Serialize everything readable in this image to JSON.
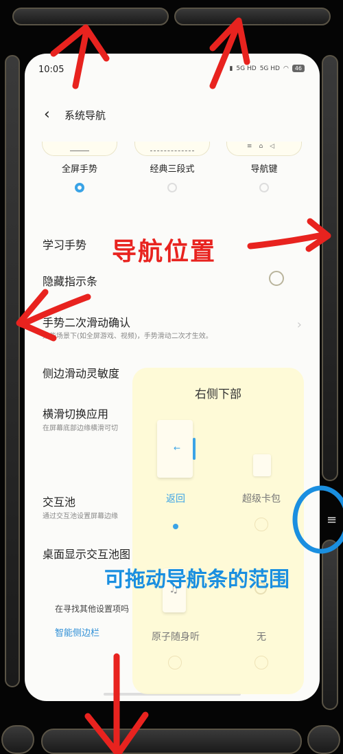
{
  "status_bar": {
    "time": "10:05",
    "signal1": "5G HD",
    "signal2": "5G HD",
    "battery": "46"
  },
  "header": {
    "title": "系统导航"
  },
  "nav_modes": {
    "options": [
      {
        "label": "全屏手势",
        "selected": true
      },
      {
        "label": "经典三段式",
        "selected": false
      },
      {
        "label": "导航键",
        "selected": false
      }
    ]
  },
  "settings": {
    "learn_gesture": "学习手势",
    "hide_indicator": "隐藏指示条",
    "gesture_confirm": "手势二次滑动确认",
    "gesture_confirm_desc": "某些场景下(如全屏游戏、视频)，手势滑动二次才生效。",
    "side_sensitivity": "侧边滑动灵敏度",
    "swipe_switch": "横滑切换应用",
    "swipe_switch_desc": "在屏幕底部边缘横滑可切",
    "interaction_pool": "交互池",
    "interaction_pool_desc": "通过交互池设置屏幕边缘",
    "desktop_pool": "桌面显示交互池图",
    "search_hint": "在寻找其他设置项吗",
    "smart_sidebar": "智能侧边栏"
  },
  "overlay": {
    "title": "右侧下部",
    "items": [
      "返回",
      "超级卡包",
      "原子随身听",
      "无"
    ]
  },
  "annotations": {
    "nav_position": "导航位置",
    "drag_range": "可拖动导航条的范围"
  },
  "colors": {
    "accent": "#3aa3e6",
    "annotation_red": "#e8231f",
    "annotation_blue": "#1a8fe0"
  }
}
